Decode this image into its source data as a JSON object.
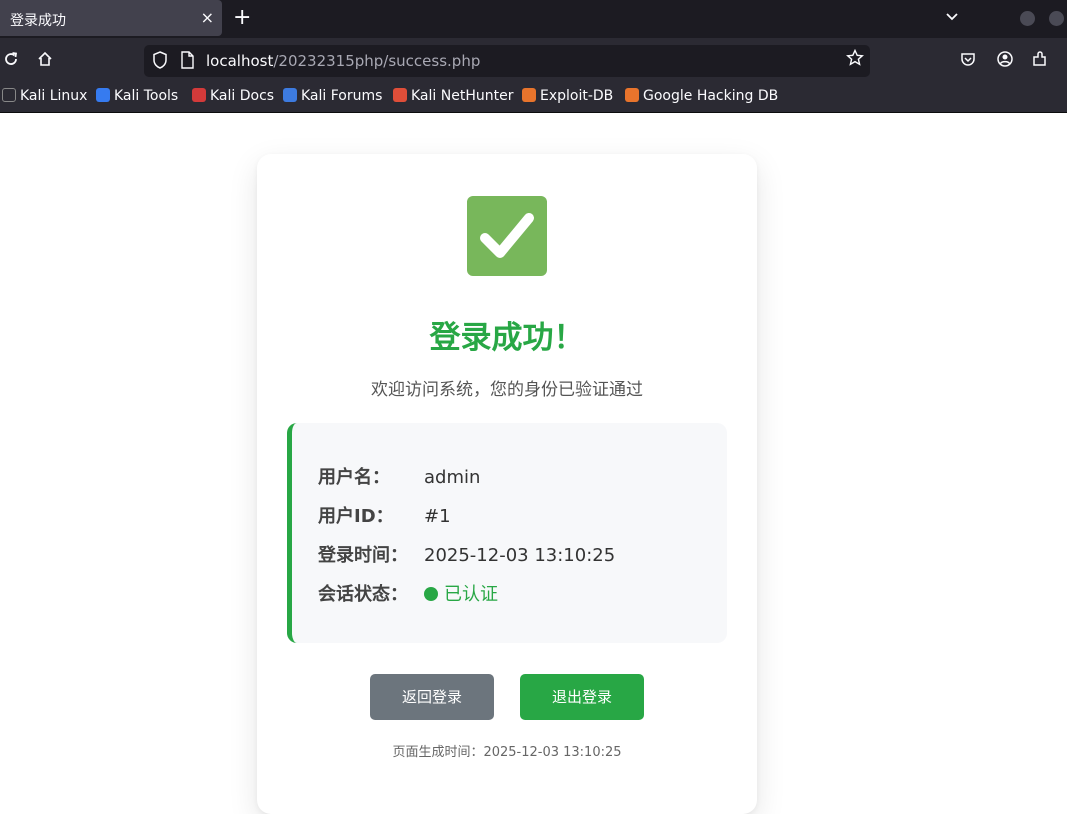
{
  "browser": {
    "tab_title": "登录成功",
    "tab_close": "×",
    "new_tab": "+",
    "url_host": "localhost",
    "url_path": "/20232315php/success.php"
  },
  "bookmarks": [
    {
      "label": "Kali Linux",
      "color": "#2f7ed8"
    },
    {
      "label": "Kali Tools",
      "color": "#367bf0"
    },
    {
      "label": "Kali Docs",
      "color": "#d33a3a"
    },
    {
      "label": "Kali Forums",
      "color": "#3d7be0"
    },
    {
      "label": "Kali NetHunter",
      "color": "#e04e39"
    },
    {
      "label": "Exploit-DB",
      "color": "#e8742c"
    },
    {
      "label": "Google Hacking DB",
      "color": "#e8742c"
    }
  ],
  "page": {
    "headline": "登录成功！",
    "subtitle": "欢迎访问系统，您的身份已验证通过",
    "info": {
      "username_label": "用户名：",
      "username_value": "admin",
      "userid_label": "用户ID：",
      "userid_value": "#1",
      "logintime_label": "登录时间：",
      "logintime_value": "2025-12-03 13:10:25",
      "session_label": "会话状态：",
      "session_value": "已认证"
    },
    "buttons": {
      "back": "返回登录",
      "logout": "退出登录"
    },
    "footer": "页面生成时间：2025-12-03 13:10:25"
  },
  "colors": {
    "accent": "#28a745",
    "secondary_button": "#6c757d",
    "check_bg": "#78b75b"
  }
}
